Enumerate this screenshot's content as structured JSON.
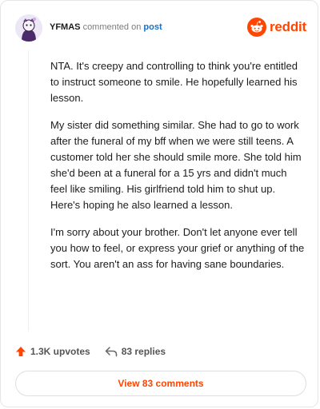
{
  "comment": {
    "username": "YFMAS",
    "action_text": "commented on",
    "post_link": "post",
    "paragraphs": [
      "NTA. It's creepy and controlling to think you're entitled to instruct someone to smile. He hopefully learned his lesson.",
      "My sister did something similar. She had to go to work after the funeral of my bff when we were still teens. A customer told her she should smile more. She told him she'd been at a funeral for a 15 yrs and didn't much feel like smiling. His girlfriend told him to shut up. Here's hoping he also learned a lesson.",
      "I'm sorry about your brother. Don't let anyone ever tell you how to feel, or express your grief or anything of the sort. You aren't an ass for having sane boundaries."
    ]
  },
  "brand": {
    "wordmark": "reddit",
    "icon": "reddit-snoo-icon",
    "color": "#ff4500"
  },
  "actions": {
    "upvotes": "1.3K upvotes",
    "upvote_icon": "upvote-arrow-icon",
    "replies": "83 replies",
    "reply_icon": "reply-arrow-icon"
  },
  "view_button": {
    "label": "View 83 comments"
  }
}
